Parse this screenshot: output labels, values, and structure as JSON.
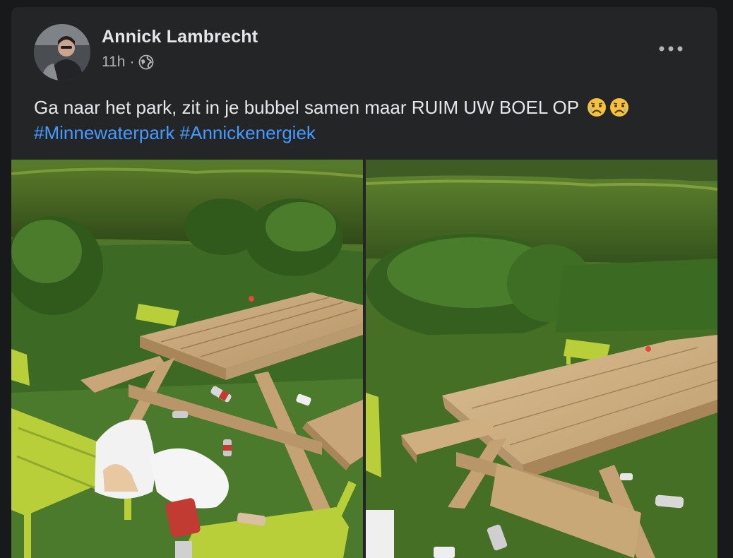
{
  "post": {
    "author": "Annick Lambrecht",
    "time": "11h",
    "separator": "·",
    "audience_icon": "globe-icon",
    "more_icon": "more-options-icon",
    "text": "Ga naar het park, zit in je bubbel samen maar RUIM UW BOEL OP",
    "emojis": [
      "crying-face-emoji",
      "crying-face-emoji"
    ],
    "hashtags": [
      "#Minnewaterpark",
      "#Annickenergiek"
    ]
  },
  "photos": [
    {
      "name": "photo-picnic-table-litter-1"
    },
    {
      "name": "photo-picnic-table-litter-2"
    }
  ],
  "colors": {
    "background": "#18191a",
    "card": "#242526",
    "text_primary": "#e4e6eb",
    "text_secondary": "#b0b3b8",
    "link": "#4599ff"
  }
}
